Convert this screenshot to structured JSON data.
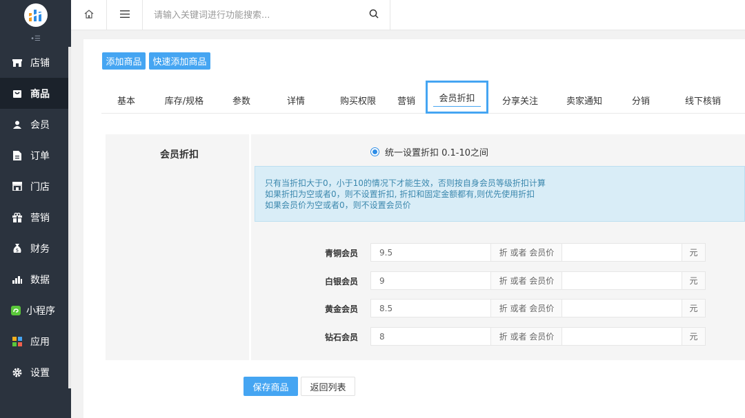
{
  "sidebar": {
    "items": [
      {
        "label": "店铺",
        "icon": "store-icon"
      },
      {
        "label": "商品",
        "icon": "goods-icon"
      },
      {
        "label": "会员",
        "icon": "member-icon"
      },
      {
        "label": "订单",
        "icon": "order-icon"
      },
      {
        "label": "门店",
        "icon": "shop-icon"
      },
      {
        "label": "营销",
        "icon": "gift-icon"
      },
      {
        "label": "财务",
        "icon": "money-bag-icon"
      },
      {
        "label": "数据",
        "icon": "bar-chart-icon"
      },
      {
        "label": "小程序",
        "icon": "mini-program-icon"
      },
      {
        "label": "应用",
        "icon": "apps-icon"
      },
      {
        "label": "设置",
        "icon": "gear-icon"
      }
    ],
    "active_index": 1
  },
  "topbar": {
    "search_placeholder": "请输入关键词进行功能搜索..."
  },
  "actions": {
    "add_goods": "添加商品",
    "quick_add_goods": "快速添加商品"
  },
  "tabs": [
    "基本",
    "库存/规格",
    "参数",
    "详情",
    "购买权限",
    "营销",
    "会员折扣",
    "分享关注",
    "卖家通知",
    "分销",
    "线下核销"
  ],
  "active_tab": "会员折扣",
  "discount": {
    "section_label": "会员折扣",
    "radio_label": "统一设置折扣 0.1-10之间",
    "notice": [
      "只有当折扣大于0，小于10的情况下才能生效，否则按自身会员等级折扣计算",
      "如果折扣为空或者0，则不设置折扣, 折扣和固定金额都有,则优先使用折扣",
      "如果会员价为空或者0，则不设置会员价"
    ],
    "addon_discount": "折 或者 会员价",
    "addon_unit": "元",
    "levels": [
      {
        "name": "青铜会员",
        "discount": "9.5",
        "price": ""
      },
      {
        "name": "白银会员",
        "discount": "9",
        "price": ""
      },
      {
        "name": "黄金会员",
        "discount": "8.5",
        "price": ""
      },
      {
        "name": "钻石会员",
        "discount": "8",
        "price": ""
      }
    ]
  },
  "footer": {
    "save": "保存商品",
    "back": "返回列表"
  },
  "colors": {
    "sidebar_bg": "#2b333e",
    "accent": "#45a5f2",
    "notice_bg": "#d9edf7",
    "notice_text": "#3a87ad"
  }
}
